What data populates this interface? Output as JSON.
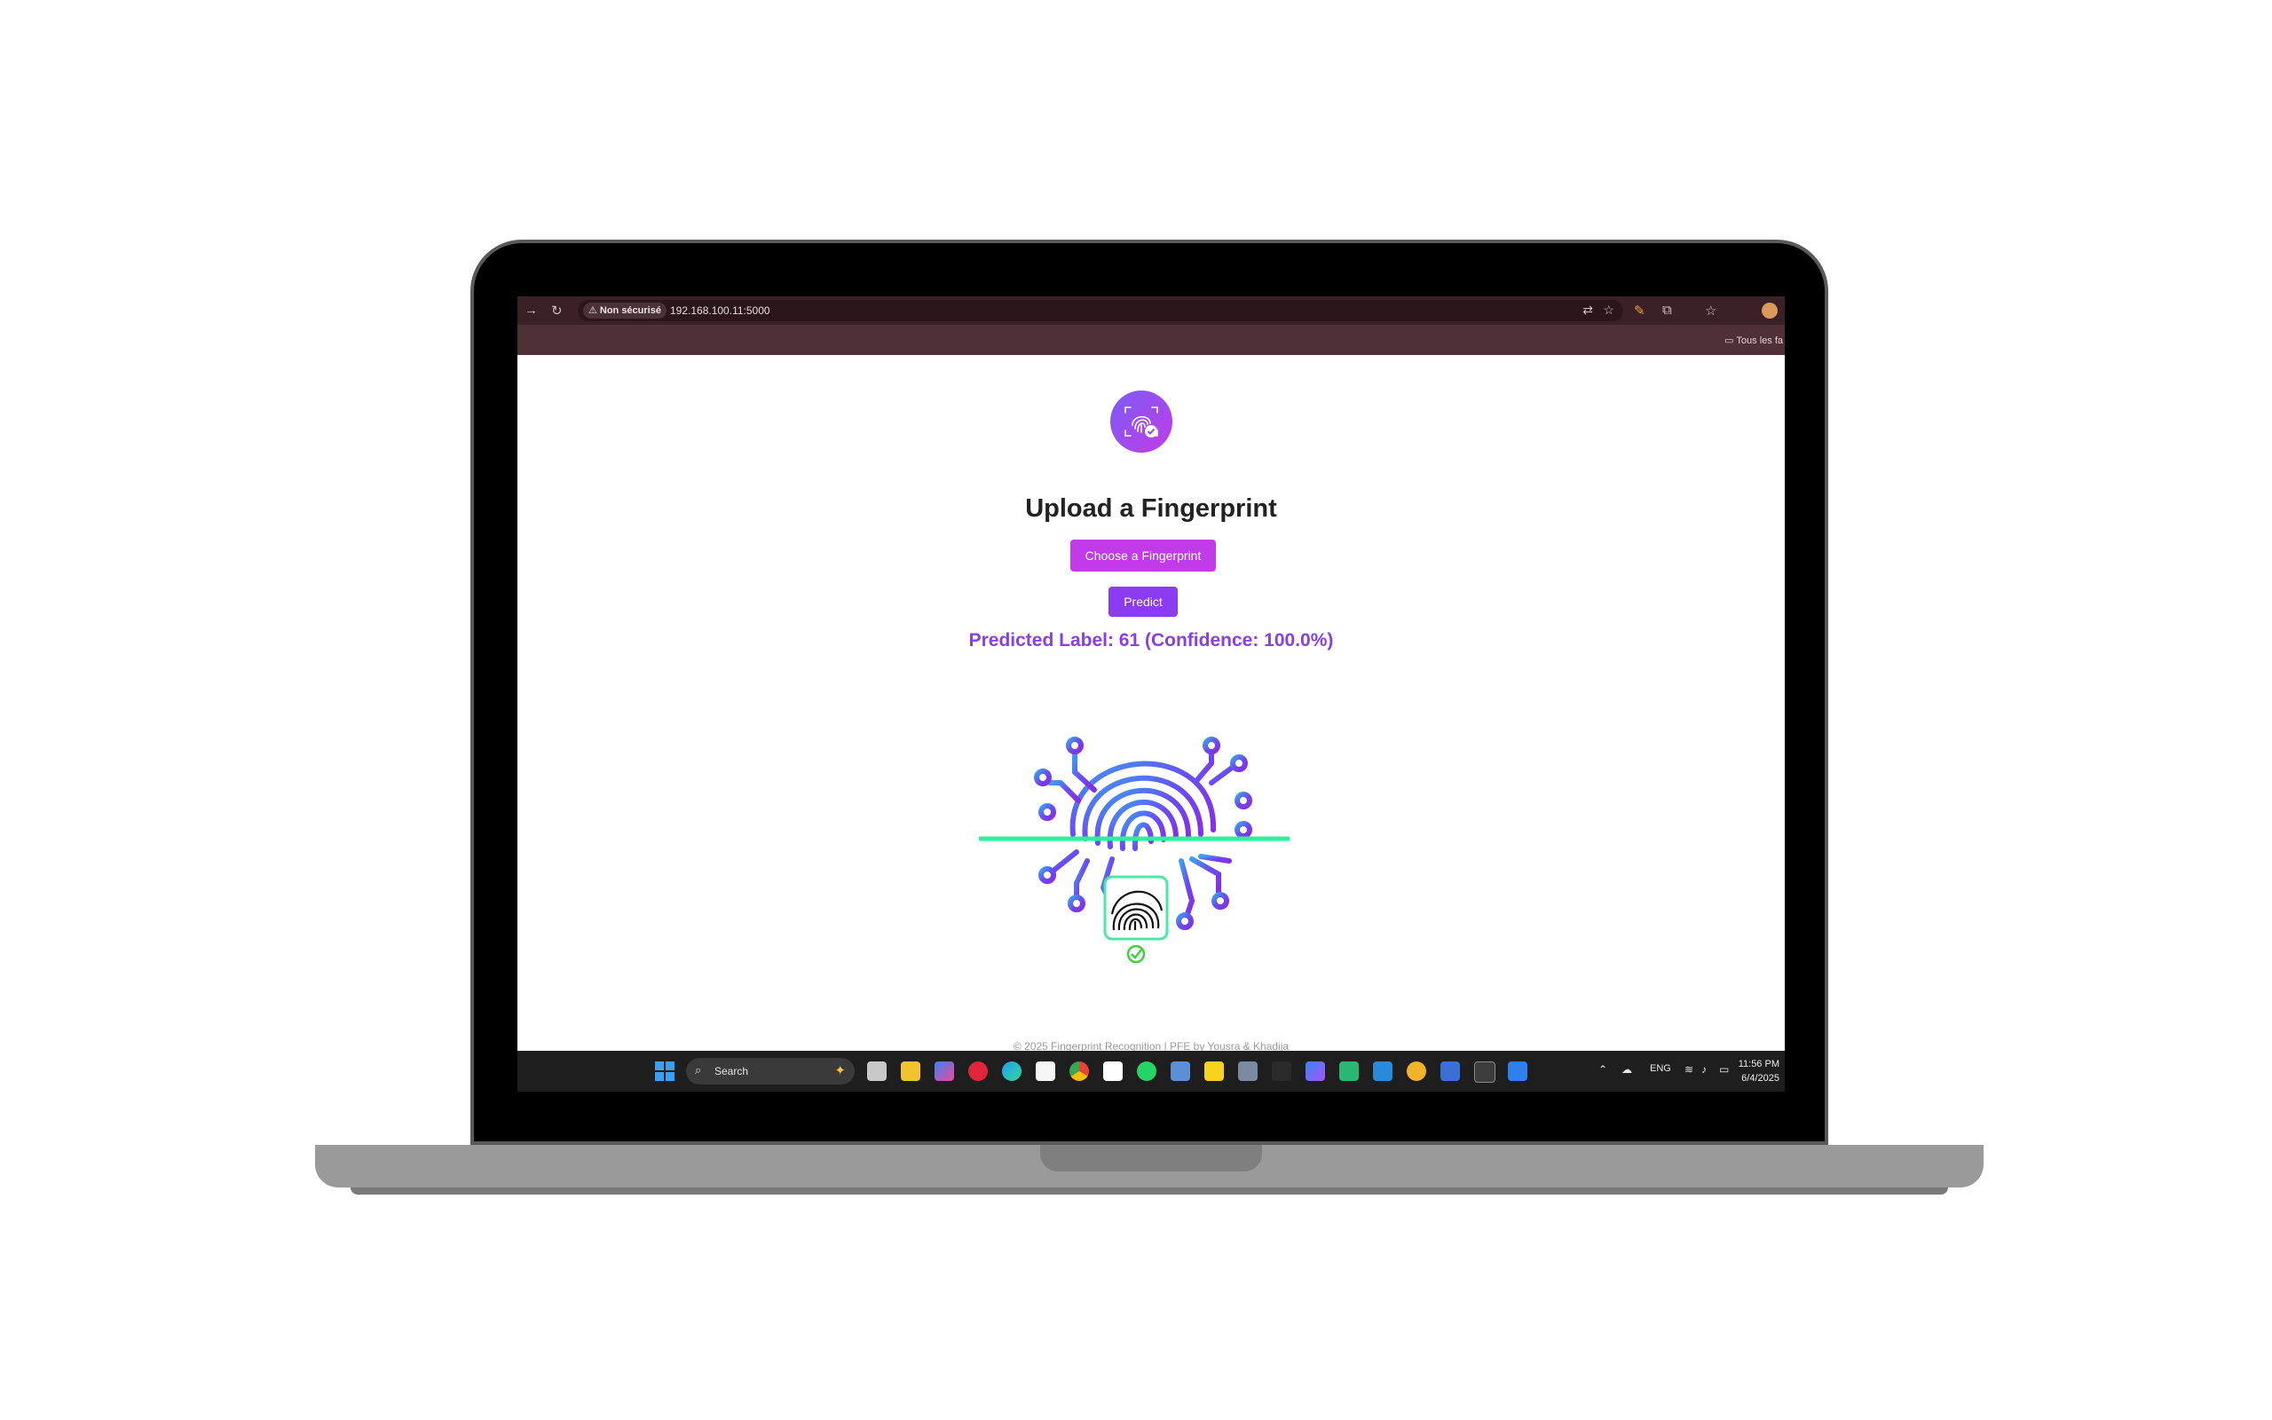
{
  "browser": {
    "security_label": "Non sécurisé",
    "url": "192.168.100.11:5000",
    "bookmarks_folder": "Tous les fa"
  },
  "page": {
    "title": "Upload a Fingerprint",
    "choose_button": "Choose a Fingerprint",
    "predict_button": "Predict",
    "result": "Predicted Label: 61 (Confidence: 100.0%)",
    "footer": "© 2025 Fingerprint Recognition | PFE by Yousra & Khadija"
  },
  "taskbar": {
    "search_placeholder": "Search",
    "language": "ENG",
    "time": "11:56 PM",
    "date": "6/4/2025"
  },
  "colors": {
    "accent_magenta": "#c13ce8",
    "accent_purple": "#8b3bf0",
    "result_text": "#8a3fe3",
    "scan_line": "#2df09a",
    "browser_frame": "#3b2126"
  }
}
